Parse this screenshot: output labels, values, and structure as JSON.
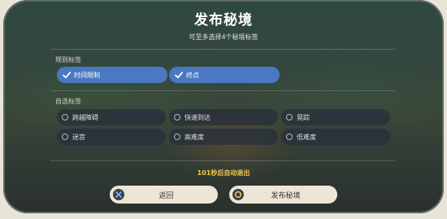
{
  "dialog": {
    "title": "发布秘境",
    "subtitle": "可至多选择4个秘境标签"
  },
  "rule_tags": {
    "label": "规则标签",
    "items": [
      {
        "label": "时间限制",
        "selected": true
      },
      {
        "label": "终点",
        "selected": true
      }
    ]
  },
  "optional_tags": {
    "label": "自选标签",
    "items": [
      {
        "label": "跨越障碍",
        "selected": false
      },
      {
        "label": "快速到达",
        "selected": false
      },
      {
        "label": "晃踪",
        "selected": false
      },
      {
        "label": "迷宫",
        "selected": false
      },
      {
        "label": "高难度",
        "selected": false
      },
      {
        "label": "低难度",
        "selected": false
      }
    ]
  },
  "countdown": "101秒后自动退出",
  "buttons": {
    "back_label": "返回",
    "publish_label": "发布秘境"
  },
  "icons": {
    "check": "check-icon",
    "back": "close-x-icon",
    "publish": "circle-confirm-icon"
  },
  "colors": {
    "selected_chip": "#4a78c2",
    "countdown_text": "#f2c949",
    "button_bg": "#ede6d6",
    "icon_circle": "#3b3f4a",
    "back_icon_accent": "#7fb0ff",
    "publish_icon_accent": "#f2c949"
  }
}
